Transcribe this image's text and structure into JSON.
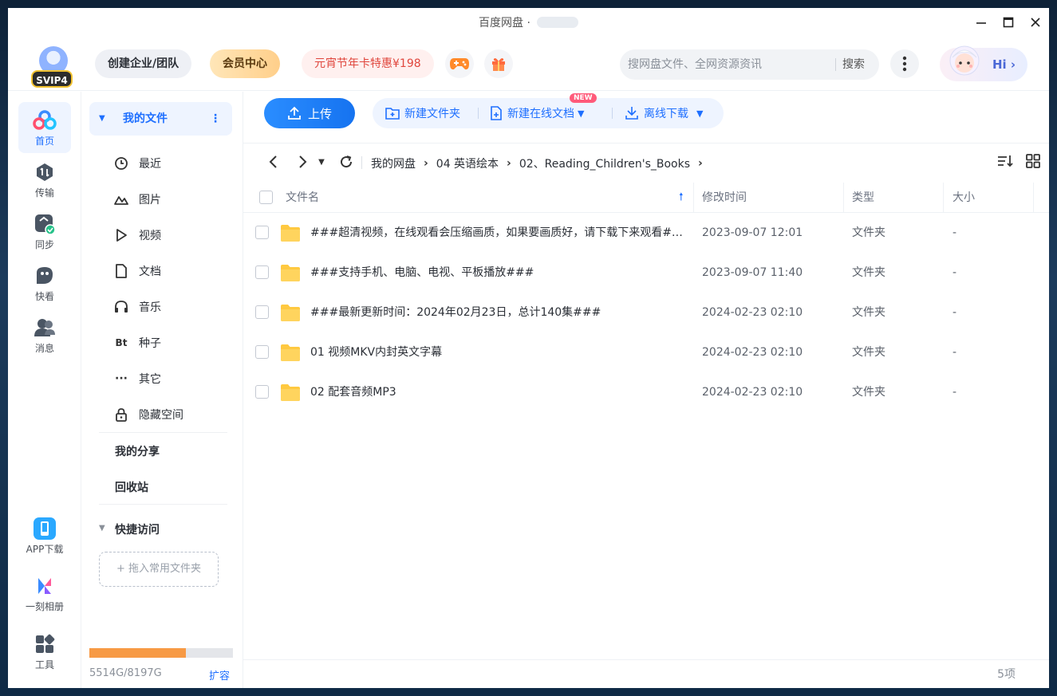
{
  "window": {
    "title": "百度网盘 ·",
    "controls": {
      "minimize": "minimize-icon",
      "maximize": "maximize-icon",
      "close": "close-icon"
    }
  },
  "header": {
    "logo_badge": "SVIP4",
    "team_button": "创建企业/团队",
    "vip_button": "会员中心",
    "promo_button": "元宵节年卡特惠¥198",
    "game_icon": "gamepad-icon",
    "gift_icon": "gift-icon",
    "search": {
      "placeholder": "搜网盘文件、全网资源资讯",
      "value": "",
      "button": "搜索"
    },
    "more_icon": "more-vertical-icon",
    "greeting": "Hi"
  },
  "rail": {
    "items": [
      {
        "label": "首页",
        "icon": "home-cloud-icon",
        "active": true
      },
      {
        "label": "传输",
        "icon": "transfer-icon",
        "active": false
      },
      {
        "label": "同步",
        "icon": "sync-icon",
        "active": false
      },
      {
        "label": "快看",
        "icon": "quick-view-icon",
        "active": false
      },
      {
        "label": "消息",
        "icon": "message-icon",
        "active": false
      }
    ],
    "bottom_items": [
      {
        "label": "APP下载",
        "icon": "phone-icon"
      },
      {
        "label": "一刻相册",
        "icon": "album-icon"
      },
      {
        "label": "工具",
        "icon": "tools-icon"
      }
    ]
  },
  "sidebar": {
    "my_files": "我的文件",
    "items": [
      {
        "label": "最近",
        "icon": "clock-icon"
      },
      {
        "label": "图片",
        "icon": "image-icon"
      },
      {
        "label": "视频",
        "icon": "play-icon"
      },
      {
        "label": "文档",
        "icon": "document-icon"
      },
      {
        "label": "音乐",
        "icon": "headphones-icon"
      },
      {
        "label": "种子",
        "icon": "bt-icon",
        "glyph": "Bt"
      },
      {
        "label": "其它",
        "icon": "more-horizontal-icon",
        "glyph": "···"
      },
      {
        "label": "隐藏空间",
        "icon": "lock-icon"
      }
    ],
    "my_share": "我的分享",
    "recycle": "回收站",
    "quick_access": "快捷访问",
    "drop_hint": "+ 拖入常用文件夹",
    "quota": {
      "text": "5514G/8197G",
      "used_ratio": 0.673,
      "expand": "扩容"
    }
  },
  "toolbar": {
    "upload": "上传",
    "new_folder": "新建文件夹",
    "new_doc": "新建在线文档",
    "new_badge": "NEW",
    "offline_download": "离线下载"
  },
  "breadcrumb": [
    "我的网盘",
    "04 英语绘本",
    "02、Reading_Children's_Books"
  ],
  "table": {
    "headers": {
      "name": "文件名",
      "mtime": "修改时间",
      "type": "类型",
      "size": "大小"
    },
    "rows": [
      {
        "name": "###超清视频，在线观看会压缩画质，如果要画质好，请下载下来观看###",
        "mtime": "2023-09-07 12:01",
        "type": "文件夹",
        "size": "-"
      },
      {
        "name": "###支持手机、电脑、电视、平板播放###",
        "mtime": "2023-09-07 11:40",
        "type": "文件夹",
        "size": "-"
      },
      {
        "name": "###最新更新时间：2024年02月23日，总计140集###",
        "mtime": "2024-02-23 02:10",
        "type": "文件夹",
        "size": "-"
      },
      {
        "name": "01 视频MKV内封英文字幕",
        "mtime": "2024-02-23 02:10",
        "type": "文件夹",
        "size": "-"
      },
      {
        "name": "02 配套音频MP3",
        "mtime": "2024-02-23 02:10",
        "type": "文件夹",
        "size": "-"
      }
    ]
  },
  "status": {
    "count": "5项"
  },
  "colors": {
    "accent": "#1e6fff",
    "folder": "#ffc940",
    "quota": "#f79a45"
  }
}
